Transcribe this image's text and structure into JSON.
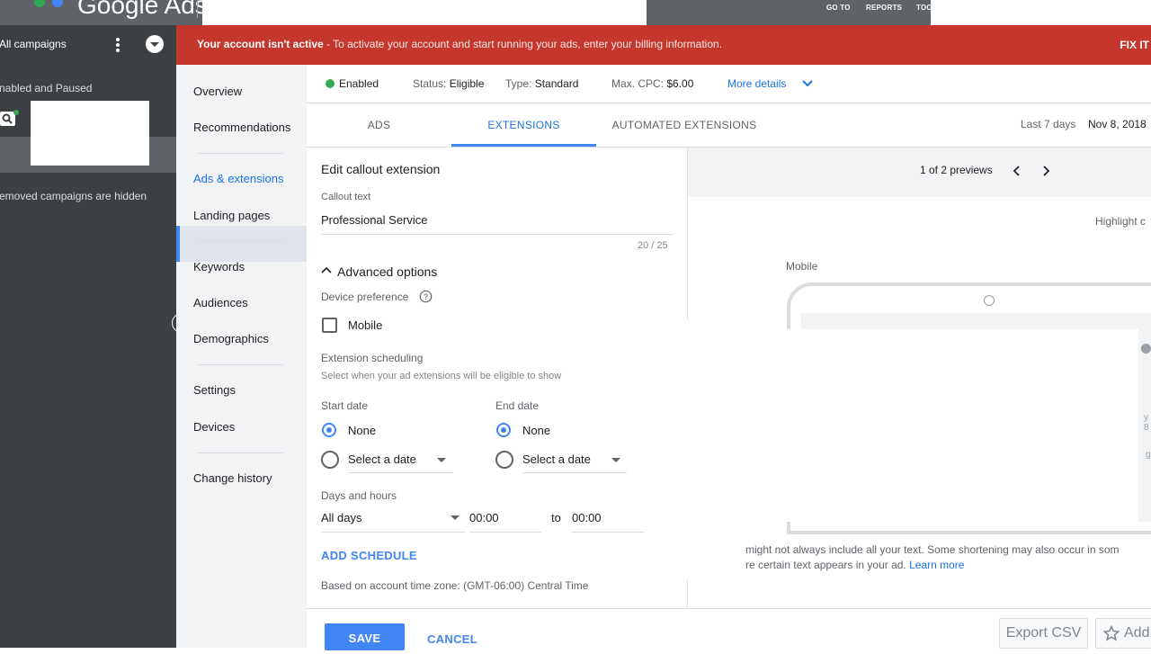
{
  "topbar": {
    "app_name": "Google Ads",
    "nav": [
      "GO TO",
      "REPORTS",
      "TOO"
    ]
  },
  "sidebar": {
    "scope_label": "All campaigns",
    "filter_label": "nabled and Paused",
    "hidden_note": "emoved campaigns are hidden"
  },
  "banner": {
    "bold": "Your account isn't active",
    "message": " - To activate your account and start running your ads, enter your billing information.",
    "action": "FIX IT"
  },
  "page_menu": {
    "items": [
      "Overview",
      "Recommendations",
      "Ads & extensions",
      "Landing pages",
      "Keywords",
      "Audiences",
      "Demographics",
      "Settings",
      "Devices",
      "Change history"
    ]
  },
  "status_row": {
    "enabled": "Enabled",
    "status_label": "Status:",
    "status_value": "Eligible",
    "type_label": "Type:",
    "type_value": "Standard",
    "cpc_label": "Max. CPC:",
    "cpc_value": "$6.00",
    "more": "More details"
  },
  "tabs": {
    "items": [
      "ADS",
      "EXTENSIONS",
      "AUTOMATED EXTENSIONS"
    ],
    "active": "EXTENSIONS",
    "range_label": "Last 7 days",
    "range_value": "Nov 8, 2018"
  },
  "edit": {
    "title": "Edit callout extension",
    "callout_label": "Callout text",
    "callout_value": "Professional Service",
    "char_count": "20 / 25",
    "advanced": "Advanced options",
    "device_pref": "Device preference",
    "mobile": "Mobile",
    "scheduling": "Extension scheduling",
    "scheduling_help": "Select when your ad extensions will be eligible to show",
    "start_date": "Start date",
    "end_date": "End date",
    "none": "None",
    "select_date": "Select a date",
    "days_hours": "Days and hours",
    "days_value": "All days",
    "from_time": "00:00",
    "to": "to",
    "to_time": "00:00",
    "add_schedule": "ADD SCHEDULE",
    "timezone": "Based on account time zone: (GMT-06:00) Central Time"
  },
  "preview": {
    "counter": "1 of 2 previews",
    "highlight": "Highlight c",
    "device": "Mobile",
    "note_1": "might not always include all your text. Some shortening may also occur in som",
    "note_2": "re certain text appears in your ad.",
    "learn_more": "Learn more",
    "side_frag_1": "y 8",
    "side_frag_2": "g"
  },
  "footer": {
    "save": "SAVE",
    "cancel": "CANCEL",
    "export": "Export CSV",
    "add": "Add"
  },
  "colors": {
    "banner": "#c5372c",
    "accent": "#4285f4",
    "enabled_dot": "#34a853",
    "sidebar": "#3c4043"
  }
}
